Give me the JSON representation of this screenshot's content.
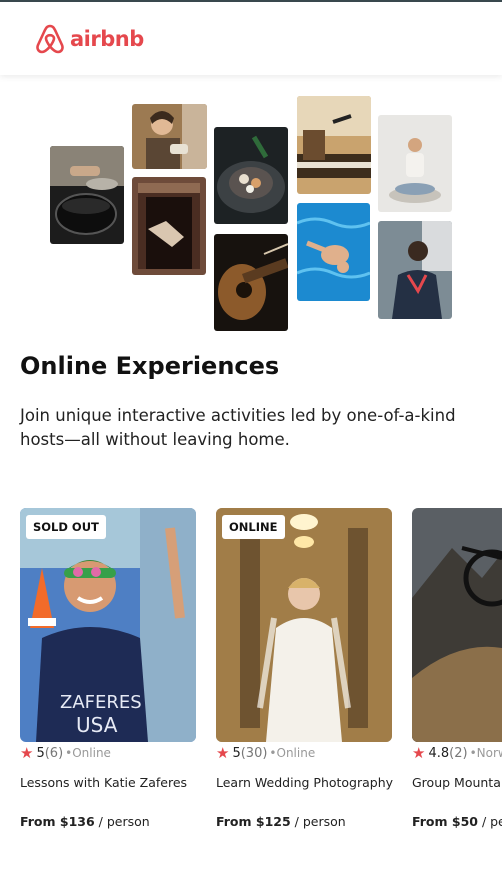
{
  "brand": {
    "name": "airbnb",
    "color": "#e5484d"
  },
  "collage": [
    {
      "name": "cooking-photo"
    },
    {
      "name": "barista-photo"
    },
    {
      "name": "doorway-dancer-photo"
    },
    {
      "name": "food-plating-photo"
    },
    {
      "name": "guitar-photo"
    },
    {
      "name": "keyboard-singer-photo"
    },
    {
      "name": "swimmer-photo"
    },
    {
      "name": "meditation-photo"
    },
    {
      "name": "rapper-photo"
    }
  ],
  "section": {
    "title": "Online Experiences",
    "subtitle": "Join unique interactive activities led by one-of-a-kind hosts—all without leaving home."
  },
  "cards": [
    {
      "badge": "SOLD OUT",
      "star": "★",
      "rating": "5",
      "count": "(6)",
      "mode": "•Online",
      "title": "Lessons with Katie Zaferes",
      "price_amount": "From $136",
      "price_unit": " / person"
    },
    {
      "badge": "ONLINE",
      "star": "★",
      "rating": "5",
      "count": "(30)",
      "mode": "•Online",
      "title": "Learn Wedding Photography",
      "price_amount": "From $125",
      "price_unit": " / person"
    },
    {
      "badge": "",
      "star": "★",
      "rating": "4.8",
      "count": "(2)",
      "mode": "•Norw",
      "title": "Group Mountai",
      "price_amount": "From $50",
      "price_unit": " / per"
    }
  ]
}
